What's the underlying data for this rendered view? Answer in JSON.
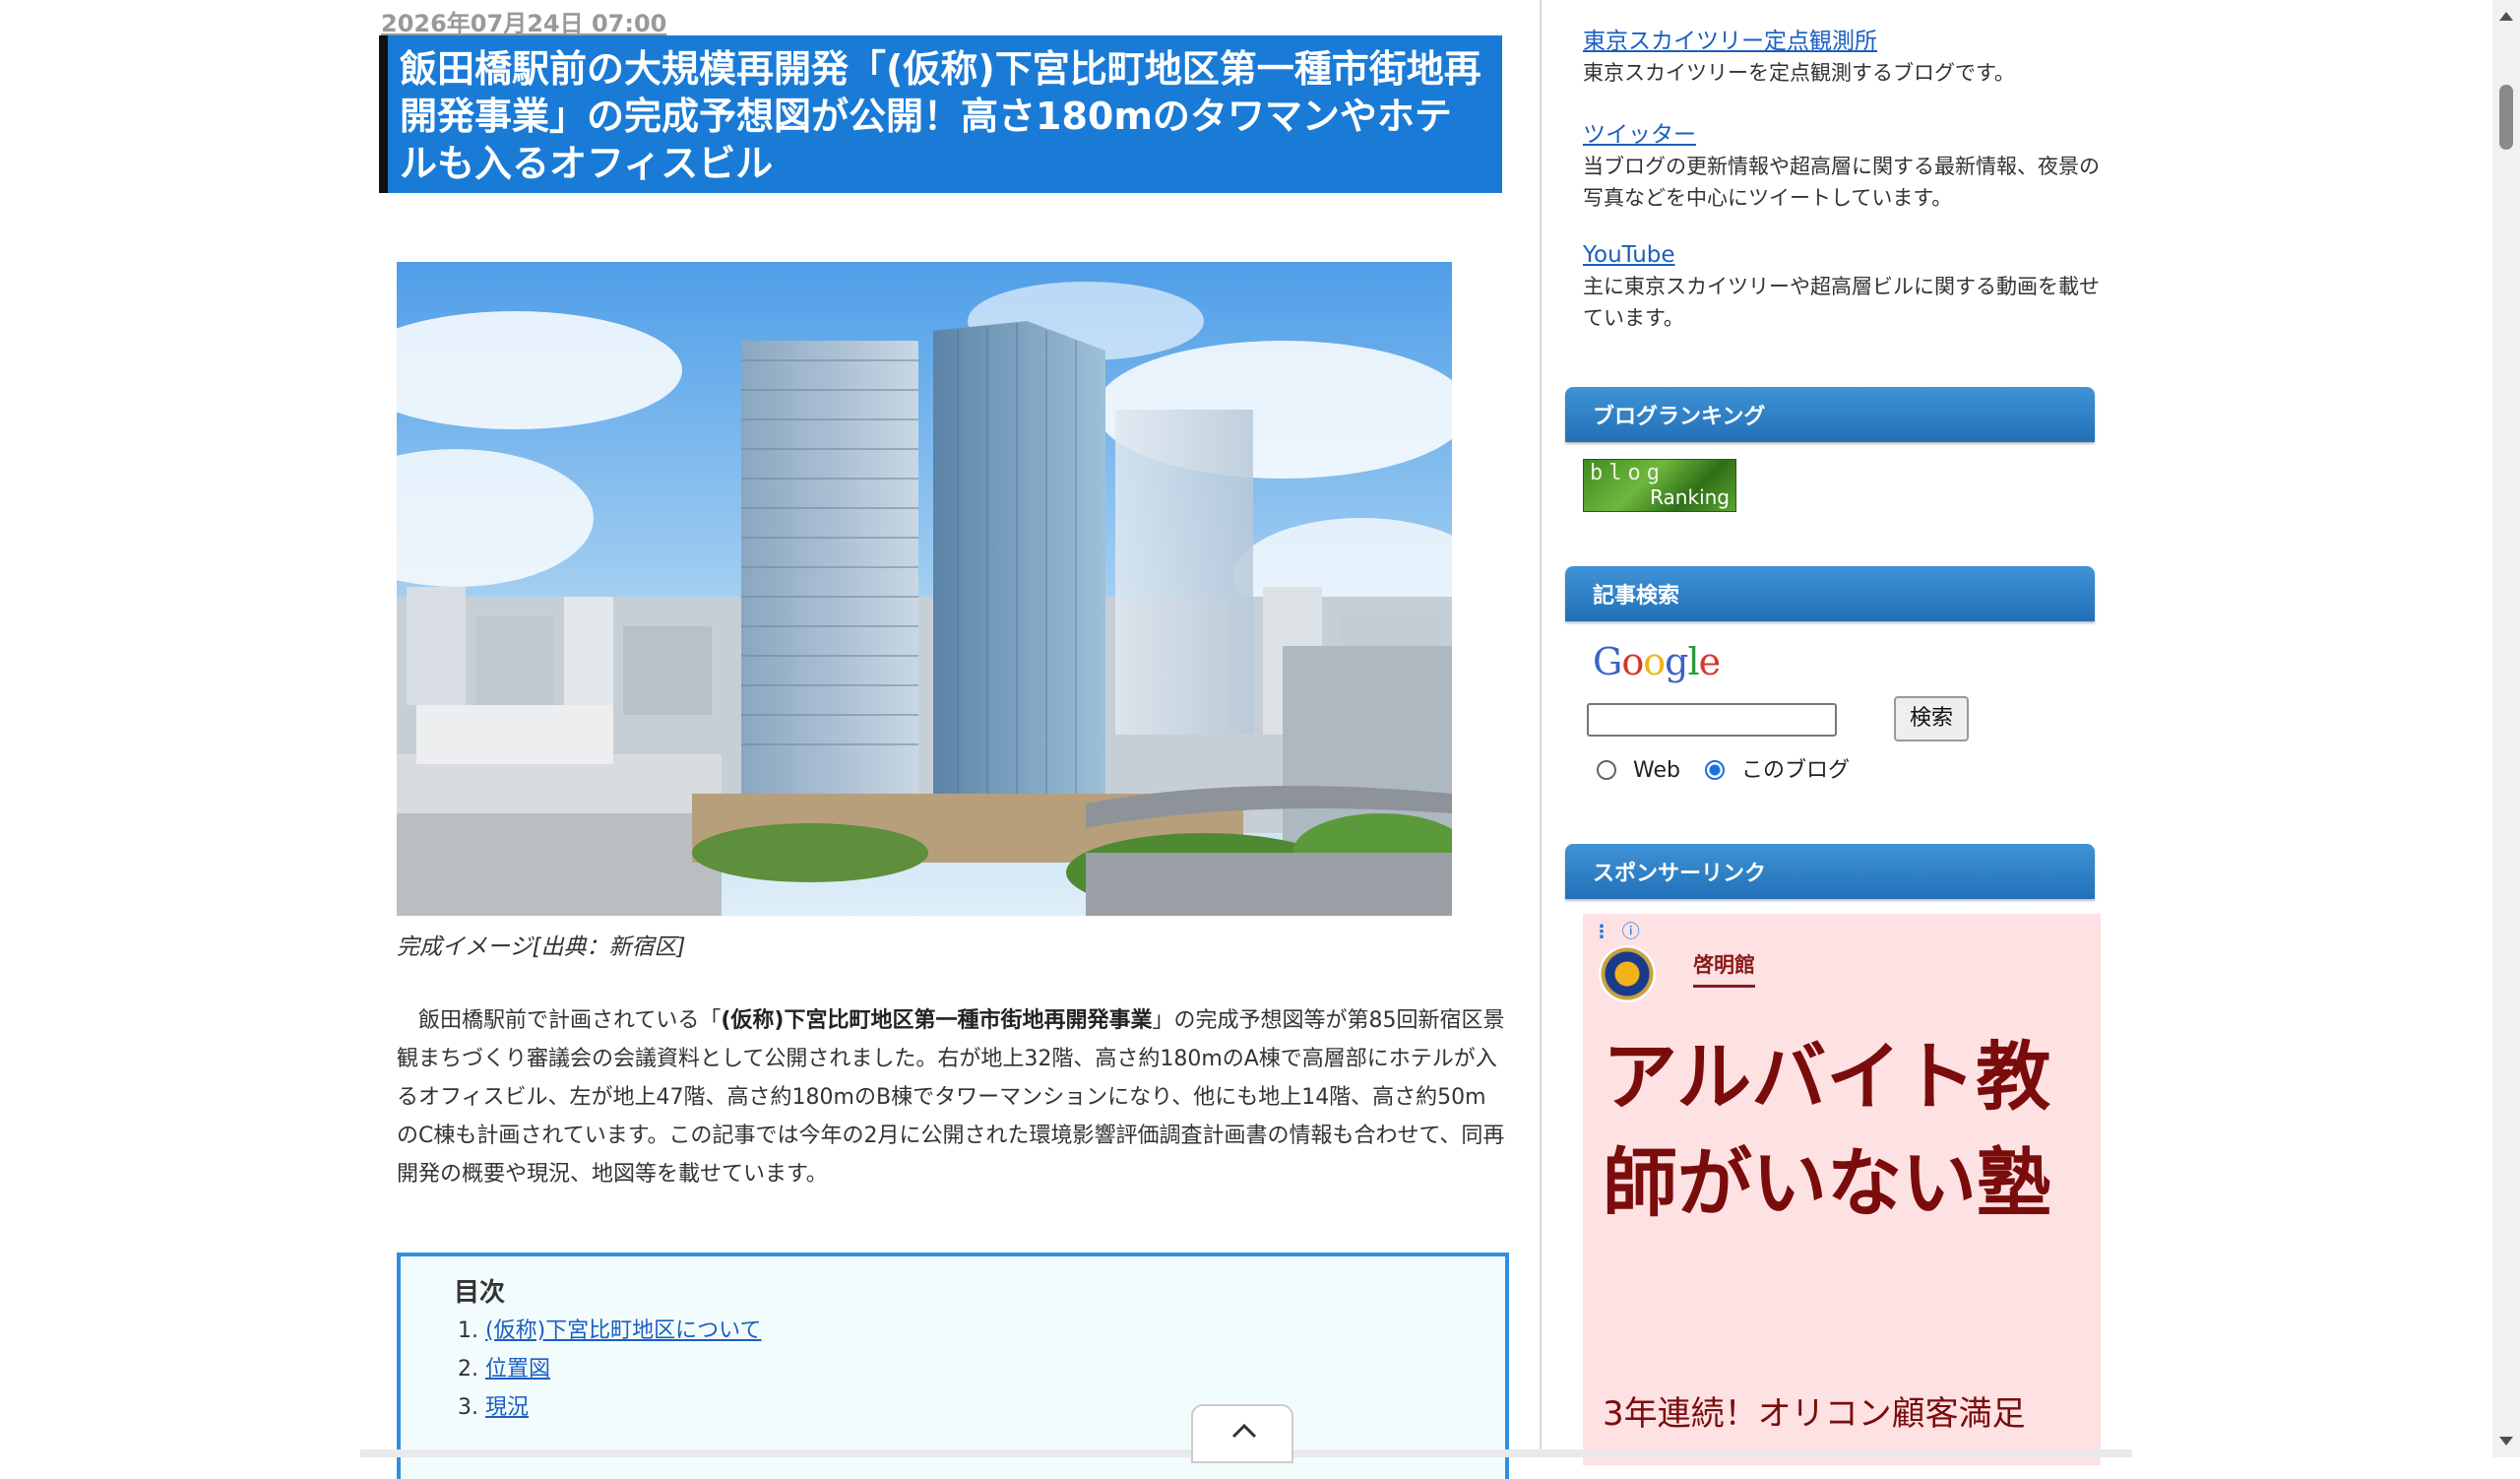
{
  "post": {
    "date": "2026年07月24日 07:00",
    "title": "飯田橋駅前の大規模再開発「(仮称)下宮比町地区第一種市街地再開発事業」の完成予想図が公開！高さ180mのタワマンやホテルも入るオフィスビル",
    "caption": "完成イメージ[出典：新宿区]",
    "body_before": "飯田橋駅前で計画されている「",
    "body_bold": "(仮称)下宮比町地区第一種市街地再開発事業",
    "body_after": "」の完成予想図等が第85回新宿区景観まちづくり審議会の会議資料として公開されました。右が地上32階、高さ約180mのA棟で高層部にホテルが入るオフィスビル、左が地上47階、高さ約180mのB棟でタワーマンションになり、他にも地上14階、高さ約50mのC棟も計画されています。この記事では今年の2月に公開された環境影響評価調査計画書の情報も合わせて、同再開発の概要や現況、地図等を載せています。"
  },
  "toc": {
    "title": "目次",
    "items": [
      {
        "num": "1.",
        "label": "(仮称)下宮比町地区について"
      },
      {
        "num": "2.",
        "label": "位置図"
      },
      {
        "num": "3.",
        "label": "現況"
      }
    ]
  },
  "sidebar": {
    "links": [
      {
        "label": "東京スカイツリー定点観測所",
        "desc": "東京スカイツリーを定点観測するブログです。"
      },
      {
        "label": "ツイッター",
        "desc": "当ブログの更新情報や超高層に関する最新情報、夜景の写真などを中心にツイートしています。"
      },
      {
        "label": "YouTube",
        "desc": "主に東京スカイツリーや超高層ビルに関する動画を載せています。"
      }
    ],
    "ranking": {
      "heading": "ブログランキング",
      "badge_top": "blog",
      "badge_bottom": "Ranking"
    },
    "search": {
      "heading": "記事検索",
      "logo": "Google",
      "button": "検索",
      "option_web": "Web",
      "option_blog": "このブログ",
      "selected": "このブログ"
    },
    "sponsor": {
      "heading": "スポンサーリンク"
    },
    "ad": {
      "brand": "啓明館",
      "headline": "アルバイト教師がいない塾",
      "sub": "3年連続！オリコン顧客満足"
    }
  },
  "colors": {
    "title_bg": "#1a7bd6",
    "widget_head": "#2f80c6",
    "ad_bg": "#fde1e3",
    "ad_text": "#7a0c0c",
    "toc_border": "#2f8fe0"
  },
  "icons": {
    "back_to_top": "chevron-up-icon",
    "ad_info": "info-icon",
    "ad_menu": "kebab-menu-icon"
  }
}
